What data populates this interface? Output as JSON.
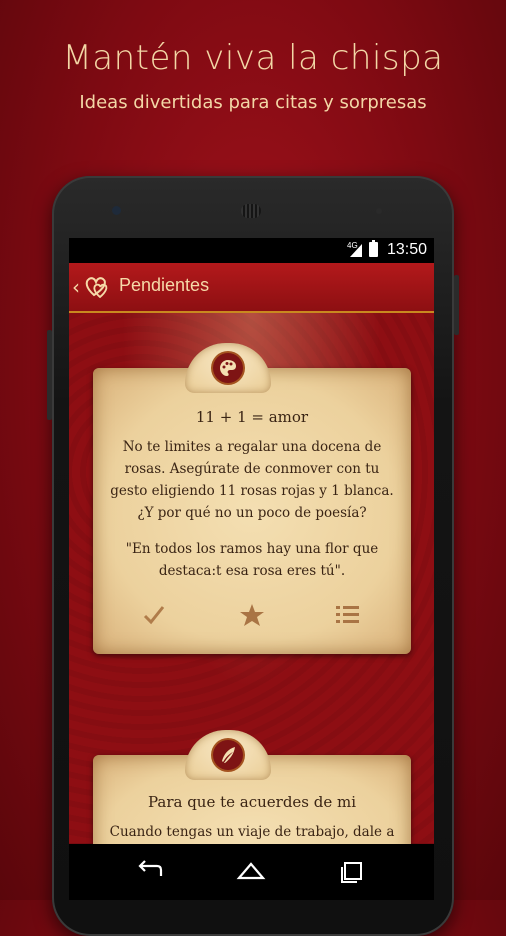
{
  "promo": {
    "headline": "Mantén viva la chispa",
    "subhead": "Ideas divertidas para citas y sorpresas"
  },
  "status_bar": {
    "network": "4G",
    "time": "13:50"
  },
  "app_bar": {
    "title": "Pendientes",
    "back_icon": "chevron-left-icon",
    "logo_icon": "hearts-icon"
  },
  "cards": [
    {
      "icon": "palette-icon",
      "title": "11 + 1 = amor",
      "body": "No te limites a regalar una docena de rosas. Asegúrate de conmover con tu gesto eligiendo 11 rosas rojas y 1 blanca. ¿Y por qué no un poco de poesía?",
      "quote": "\"En todos los ramos hay una flor que destaca:t esa rosa eres tú\".",
      "actions": [
        "check-icon",
        "star-icon",
        "list-icon"
      ]
    },
    {
      "icon": "quill-icon",
      "title": "Para que te acuerdes de mi",
      "body": "Cuando tengas un viaje de trabajo, dale a"
    }
  ],
  "nav_bar": [
    "back-icon",
    "home-icon",
    "recents-icon"
  ],
  "colors": {
    "background": "#8e0e13",
    "accent_text": "#f3d7a6",
    "parchment": "#ecd19d",
    "icon_ink": "#7e1414",
    "action_icon": "#b07c4a"
  }
}
